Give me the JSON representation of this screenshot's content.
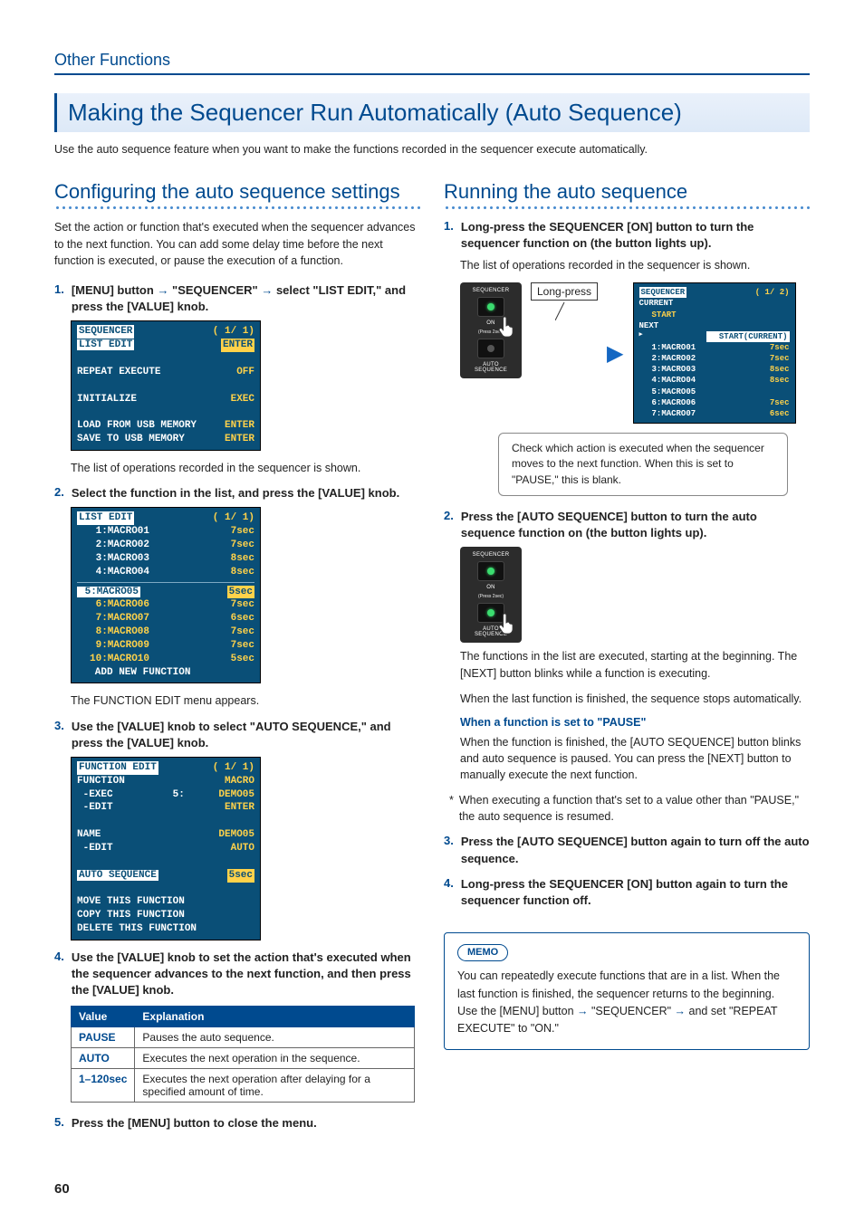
{
  "header": {
    "section": "Other Functions"
  },
  "main_title": "Making the Sequencer Run Automatically (Auto Sequence)",
  "intro": "Use the auto sequence feature when you want to make the functions recorded in the sequencer execute automatically.",
  "left": {
    "title": "Configuring the auto sequence settings",
    "lead": "Set the action or function that's executed when the sequencer advances to the next function. You can add some delay time before the next function is executed, or pause the execution of a function.",
    "step1_pre": "[MENU] button ",
    "step1_mid": " \"SEQUENCER\" ",
    "step1_post": " select \"LIST EDIT,\" and press the [VALUE] knob.",
    "lcd1": {
      "title": "SEQUENCER",
      "page": "( 1/ 1)",
      "rows": [
        [
          "LIST EDIT",
          "ENTER",
          "sel1"
        ],
        [
          "",
          ""
        ],
        [
          "REPEAT EXECUTE",
          "OFF"
        ],
        [
          "",
          ""
        ],
        [
          "INITIALIZE",
          "EXEC"
        ],
        [
          "",
          ""
        ],
        [
          "LOAD FROM USB MEMORY",
          "ENTER"
        ],
        [
          "SAVE TO USB MEMORY",
          "ENTER"
        ]
      ]
    },
    "step1_note": "The list of operations recorded in the sequencer is shown.",
    "step2": "Select the function in the list, and press the [VALUE] knob.",
    "lcd2": {
      "title": "LIST EDIT",
      "page": "( 1/ 1)",
      "rows": [
        [
          " 1:MACRO01",
          "7sec"
        ],
        [
          " 2:MACRO02",
          "7sec"
        ],
        [
          " 3:MACRO03",
          "8sec"
        ],
        [
          " 4:MACRO04",
          "8sec"
        ],
        [
          " 5:MACRO05",
          "5sec",
          "sel"
        ],
        [
          " 6:MACRO06",
          "7sec",
          "y"
        ],
        [
          " 7:MACRO07",
          "6sec",
          "y"
        ],
        [
          " 8:MACRO08",
          "7sec",
          "y"
        ],
        [
          " 9:MACRO09",
          "7sec",
          "y"
        ],
        [
          "10:MACRO10",
          "5sec",
          "y"
        ],
        [
          "   ADD NEW FUNCTION",
          ""
        ]
      ]
    },
    "step2_note": "The FUNCTION EDIT menu appears.",
    "step3": "Use the [VALUE] knob to select \"AUTO SEQUENCE,\" and press the [VALUE] knob.",
    "lcd3": {
      "title": "FUNCTION EDIT",
      "page": "( 1/ 1)",
      "lines": [
        [
          "FUNCTION",
          "MACRO"
        ],
        [
          " -EXEC          5:",
          "DEMO05"
        ],
        [
          " -EDIT",
          "ENTER"
        ],
        [
          "",
          ""
        ],
        [
          "NAME",
          "DEMO05"
        ],
        [
          " -EDIT",
          "AUTO"
        ],
        [
          "",
          ""
        ],
        [
          "AUTO SEQUENCE",
          "5sec",
          "sel"
        ],
        [
          "",
          ""
        ],
        [
          "MOVE THIS FUNCTION",
          ""
        ],
        [
          "COPY THIS FUNCTION",
          ""
        ],
        [
          "DELETE THIS FUNCTION",
          ""
        ]
      ]
    },
    "step4": "Use the [VALUE] knob to set the action that's executed when the sequencer advances to the next function, and then press the [VALUE] knob.",
    "table": {
      "head": [
        "Value",
        "Explanation"
      ],
      "rows": [
        [
          "PAUSE",
          "Pauses the auto sequence."
        ],
        [
          "AUTO",
          "Executes the next operation in the sequence."
        ],
        [
          "1–120sec",
          "Executes the next operation after delaying for a specified amount of time."
        ]
      ]
    },
    "step5": "Press the [MENU] button to close the menu."
  },
  "right": {
    "title": "Running the auto sequence",
    "step1": "Long-press the SEQUENCER [ON] button to turn the sequencer function on (the button lights up).",
    "step1_note": "The list of operations recorded in the sequencer is shown.",
    "longpress": "Long-press",
    "panel": {
      "title": "SEQUENCER",
      "on": "ON",
      "press": "(Press 2sec)",
      "auto": "AUTO\nSEQUENCE"
    },
    "lcd": {
      "title": "SEQUENCER",
      "page": "( 1/ 2)",
      "cur": "CURRENT",
      "start": "START",
      "next": "NEXT",
      "startcur": "START(CURRENT)",
      "rows": [
        [
          "1:MACRO01",
          "7sec"
        ],
        [
          "2:MACRO02",
          "7sec"
        ],
        [
          "3:MACRO03",
          "8sec"
        ],
        [
          "4:MACRO04",
          "8sec"
        ],
        [
          "5:MACRO05",
          ""
        ],
        [
          "6:MACRO06",
          "7sec"
        ],
        [
          "7:MACRO07",
          "6sec"
        ]
      ]
    },
    "callout": "Check which action is executed when the sequencer moves to the next function. When this is set to \"PAUSE,\" this is blank.",
    "step2": "Press the [AUTO SEQUENCE] button to turn the auto sequence function on (the button lights up).",
    "step2_note1": "The functions in the list are executed, starting at the beginning. The [NEXT] button blinks while a function is executing.",
    "step2_note2": "When the last function is finished, the sequence stops automatically.",
    "pause_title": "When a function is set to \"PAUSE\"",
    "pause_text": "When the function is finished, the [AUTO SEQUENCE] button blinks and auto sequence is paused. You can press the [NEXT] button to manually execute the next function.",
    "star": "When executing a function that's set to a value other than \"PAUSE,\" the auto sequence is resumed.",
    "step3": "Press the [AUTO SEQUENCE] button again to turn off the auto sequence.",
    "step4": "Long-press the SEQUENCER [ON] button again to turn the sequencer function off.",
    "memo_badge": "MEMO",
    "memo1": "You can repeatedly execute functions that are in a list. When the last function is finished, the sequencer returns to the beginning.",
    "memo2a": "Use the [MENU] button ",
    "memo2b": " \"SEQUENCER\" ",
    "memo2c": " and set \"REPEAT EXECUTE\" to \"ON.\""
  },
  "page_number": "60"
}
